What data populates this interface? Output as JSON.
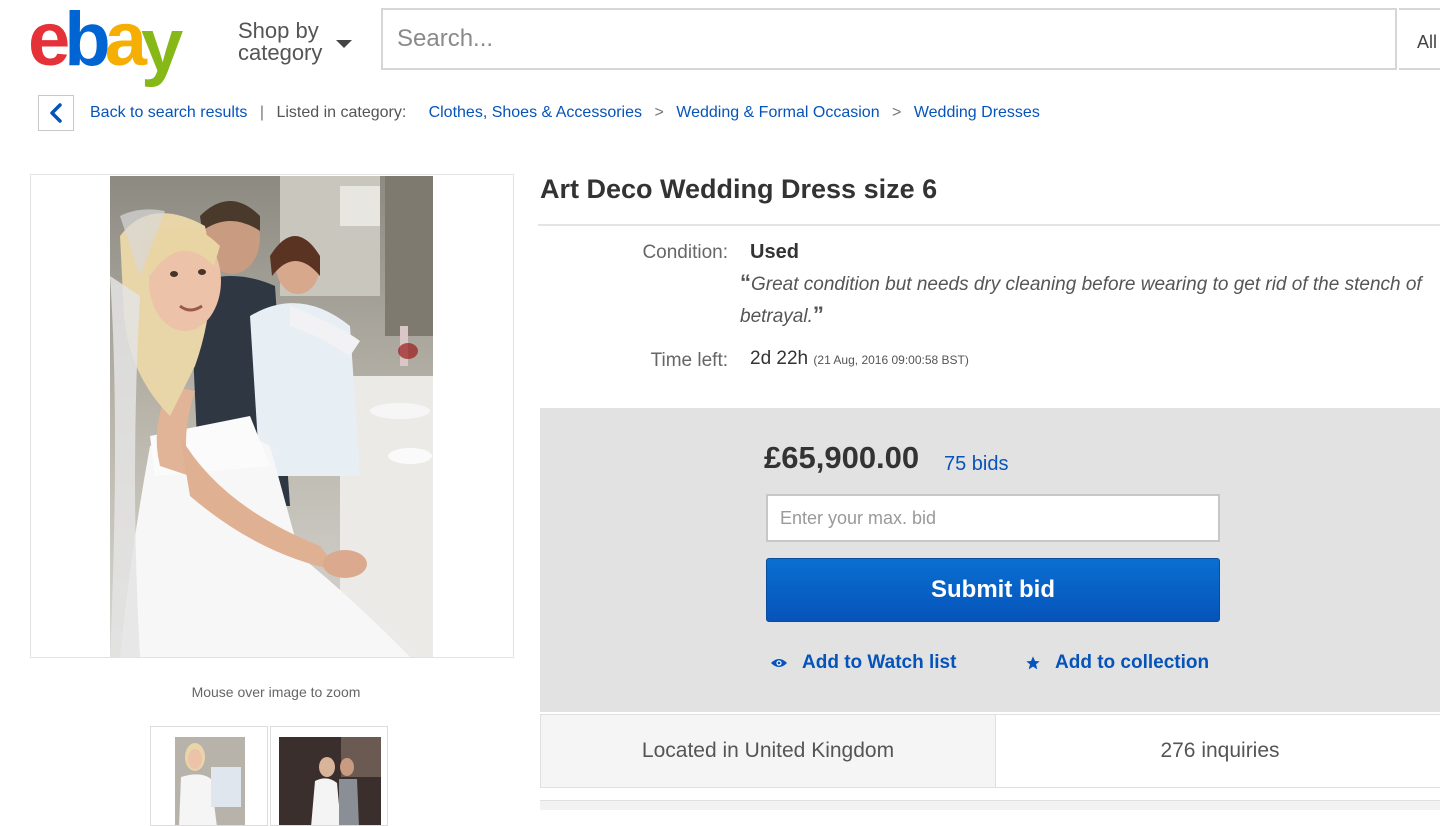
{
  "header": {
    "logo": {
      "text": [
        "e",
        "b",
        "a",
        "y"
      ],
      "colors": [
        "#e53238",
        "#0064d2",
        "#f5af02",
        "#86b817"
      ]
    },
    "shop_by_category": [
      "Shop by",
      "category"
    ],
    "search": {
      "placeholder": "Search...",
      "category": "All"
    }
  },
  "breadcrumb": {
    "back": "Back to search results",
    "listed_in": "Listed in category:",
    "categories": [
      "Clothes, Shoes & Accessories",
      "Wedding & Formal Occasion",
      "Wedding Dresses"
    ],
    "separator": ">"
  },
  "gallery": {
    "zoom_hint": "Mouse over image to zoom"
  },
  "item": {
    "title": "Art Deco Wedding Dress size 6",
    "condition_label": "Condition:",
    "condition": "Used",
    "seller_note": "Great condition but needs dry cleaning before wearing to get rid of the stench of betrayal.",
    "time_left_label": "Time left:",
    "time_left": "2d 22h",
    "end_time": "(21 Aug, 2016   09:00:58 BST)"
  },
  "bid": {
    "price": "£65,900.00",
    "bids": "75 bids",
    "input_placeholder": "Enter your max. bid",
    "submit_label": "Submit bid",
    "watch_label": "Add to Watch list",
    "collection_label": "Add to collection"
  },
  "info": {
    "location": "Located in United Kingdom",
    "inquiries": "276 inquiries"
  },
  "colors": {
    "link": "#0654ba",
    "button": "#0654ba",
    "bid_panel": "#e2e2e2"
  }
}
